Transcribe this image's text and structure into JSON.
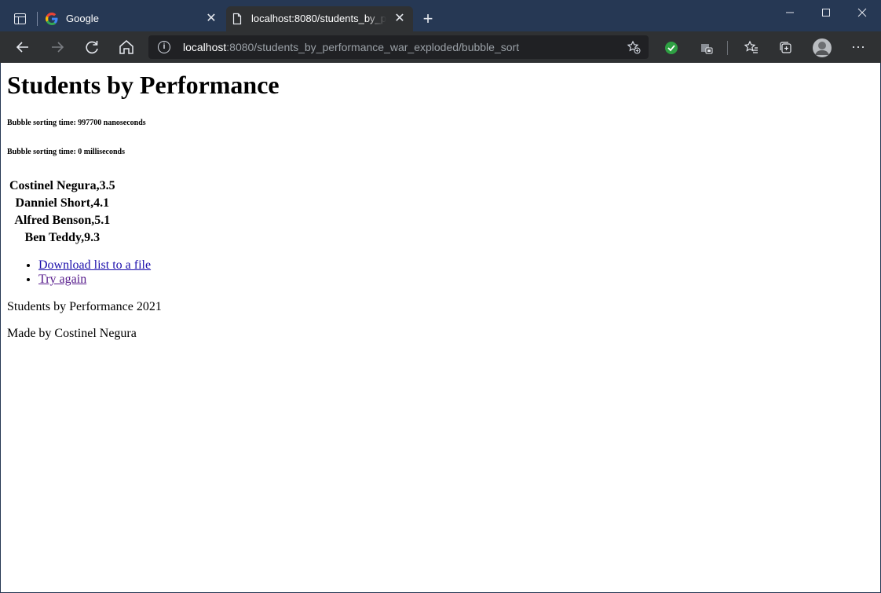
{
  "browser": {
    "tabs": [
      {
        "title": "Google",
        "favicon": "google-g-icon",
        "active": false
      },
      {
        "title": "localhost:8080/students_by_performance_war_exploded/bubble_sort",
        "favicon": "page-icon",
        "active": true
      }
    ],
    "address": {
      "host": "localhost",
      "rest": ":8080/students_by_performance_war_exploded/bubble_sort"
    },
    "accent_color": "#263854"
  },
  "page": {
    "title": "Students by Performance",
    "timing": [
      "Bubble sorting time: 997700 nanoseconds",
      "Bubble sorting time: 0 milliseconds"
    ],
    "students": [
      "Costinel Negura,3.5",
      "Danniel Short,4.1",
      "Alfred Benson,5.1",
      "Ben Teddy,9.3"
    ],
    "links": [
      {
        "label": "Download list to a file",
        "color": "#1a0dab"
      },
      {
        "label": "Try again",
        "color": "#551a8b"
      }
    ],
    "footer": [
      "Students by Performance 2021",
      "Made by Costinel Negura"
    ]
  }
}
